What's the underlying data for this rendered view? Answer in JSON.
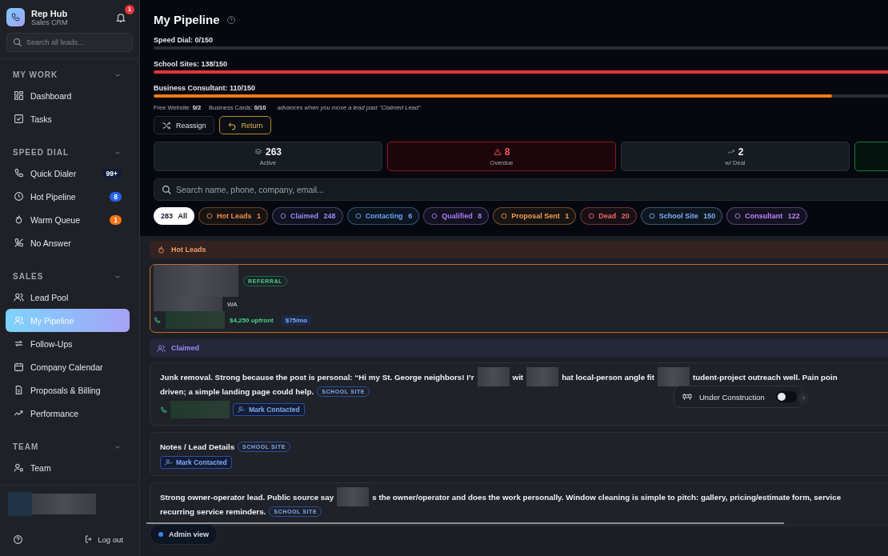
{
  "app": {
    "name": "Rep Hub",
    "subtitle": "Sales CRM",
    "notifications": "1"
  },
  "sidebar_search": {
    "placeholder": "Search all leads..."
  },
  "sections": [
    {
      "title": "MY WORK",
      "expanded": true,
      "items": [
        {
          "label": "Dashboard",
          "selected": false
        },
        {
          "label": "Tasks",
          "selected": false
        }
      ]
    },
    {
      "title": "SPEED DIAL",
      "expanded": true,
      "items": [
        {
          "label": "Quick Dialer",
          "selected": false,
          "badge": "99+",
          "color": "#0f1c3a"
        },
        {
          "label": "Hot Pipeline",
          "selected": false,
          "badge": "8",
          "color": "#2563eb"
        },
        {
          "label": "Warm Queue",
          "selected": false,
          "badge": "1",
          "color": "#f97316"
        },
        {
          "label": "No Answer",
          "selected": false
        }
      ]
    },
    {
      "title": "SALES",
      "expanded": true,
      "items": [
        {
          "label": "Lead Pool",
          "selected": false
        },
        {
          "label": "My Pipeline",
          "selected": true
        },
        {
          "label": "Follow-Ups",
          "selected": false
        },
        {
          "label": "Company Calendar",
          "selected": false
        },
        {
          "label": "Proposals & Billing",
          "selected": false
        },
        {
          "label": "Performance",
          "selected": false
        }
      ]
    },
    {
      "title": "TEAM",
      "expanded": true,
      "items": [
        {
          "label": "Team",
          "selected": false
        }
      ]
    }
  ],
  "footer": {
    "logout": "Log out"
  },
  "page": {
    "title": "My Pipeline"
  },
  "quotas": [
    {
      "label": "Speed Dial: 0/150"
    },
    {
      "label": "School Sites: 138/150",
      "level": 0.92,
      "color": "#e5343b"
    },
    {
      "label": "Business Consultant: 110/150",
      "level": 0.733,
      "color": "#f07a12"
    }
  ],
  "bonuses": [
    {
      "label": "Free Website:",
      "value": "0/2"
    },
    {
      "label": "Business Cards:",
      "value": "0/10"
    }
  ],
  "bonus_hint": "advances when you move a lead past \"Claimed Lead\"",
  "actions": [
    {
      "label": "Reassign",
      "kind": "neutral"
    },
    {
      "label": "Return",
      "kind": "warning"
    }
  ],
  "stats": [
    {
      "value": "263",
      "label": "Active",
      "kind": "neutral"
    },
    {
      "value": "8",
      "label": "Overdue",
      "kind": "danger"
    },
    {
      "value": "2",
      "label": "w/ Deal",
      "kind": "neutral"
    },
    {
      "kind": "success"
    }
  ],
  "lead_search": {
    "placeholder": "Search name, phone, company, email..."
  },
  "filters": [
    {
      "kind": "total",
      "count": "283",
      "label": "All",
      "color": "#ffffff",
      "selected": true
    },
    {
      "kind": "stage",
      "label": "Hot Leads",
      "count": "1",
      "color": "#f08a4b",
      "selected": false
    },
    {
      "kind": "stage",
      "label": "Claimed",
      "count": "248",
      "color": "#9d8cf5",
      "selected": false
    },
    {
      "kind": "stage",
      "label": "Contacting",
      "count": "6",
      "color": "#6aa4f5",
      "selected": false
    },
    {
      "kind": "stage",
      "label": "Qualified",
      "count": "8",
      "color": "#b17af5",
      "selected": false
    },
    {
      "kind": "stage",
      "label": "Proposal Sent",
      "count": "1",
      "color": "#f59e52",
      "selected": false
    },
    {
      "kind": "stage",
      "label": "Dead",
      "count": "20",
      "color": "#f06a6a",
      "selected": false
    },
    {
      "kind": "stage",
      "label": "School Site",
      "count": "150",
      "color": "#7fb0f7",
      "selected": false
    },
    {
      "kind": "stage",
      "label": "Consultant",
      "count": "122",
      "color": "#c084fc",
      "selected": false
    }
  ],
  "groups": [
    {
      "title": "Hot Leads",
      "kind": "hot",
      "cards": [
        {
          "kind": "deal",
          "tag": "REFERRAL",
          "location": "WA",
          "upfront": "$4,250 upfront",
          "monthly": "$75/mo"
        }
      ]
    },
    {
      "title": "Claimed",
      "kind": "claimed",
      "cards": [
        {
          "kind": "note",
          "phone": true,
          "tag": "SCHOOL SITE",
          "action": "Mark Contacted",
          "lines": [
            [
              {
                "kind": "text",
                "text": "Junk removal. Strong because the post is personal: “Hi my St. George neighbors! I’r"
              },
              {
                "kind": "redacted"
              },
              {
                "kind": "text",
                "text": "wit"
              },
              {
                "kind": "redacted"
              },
              {
                "kind": "text",
                "text": "hat local-person angle fit"
              },
              {
                "kind": "redacted"
              },
              {
                "kind": "text",
                "text": "tudent-project outreach well. Pain poin"
              }
            ],
            [
              {
                "kind": "text",
                "text": "driven; a simple landing page could help."
              }
            ]
          ]
        },
        {
          "kind": "note",
          "phone": false,
          "tag": "SCHOOL SITE",
          "action": "Mark Contacted",
          "lines": [
            [
              {
                "kind": "text",
                "text": "Notes / Lead Details"
              }
            ]
          ]
        },
        {
          "kind": "note",
          "tag": "SCHOOL SITE",
          "lines": [
            [
              {
                "kind": "text",
                "text": "Strong owner-operator lead. Public source say"
              },
              {
                "kind": "redacted"
              },
              {
                "kind": "text",
                "text": "s the owner/operator and does the work personally. Window cleaning is simple to pitch: gallery, pricing/estimate form, service"
              }
            ],
            [
              {
                "kind": "text",
                "text": "recurring service reminders."
              }
            ]
          ]
        }
      ]
    }
  ],
  "construction_toggle": {
    "label": "Under Construction",
    "on": false
  },
  "mode_badge": {
    "label": "Admin view"
  }
}
